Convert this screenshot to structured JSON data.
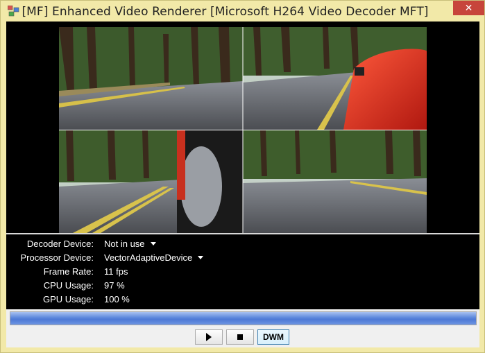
{
  "window": {
    "title": "[MF]  Enhanced Video Renderer  [Microsoft H264 Video Decoder MFT]",
    "close_glyph": "✕"
  },
  "video": {
    "description_icon": "video-frame"
  },
  "info": {
    "decoder_device": {
      "label": "Decoder Device:",
      "value": "Not in use"
    },
    "processor_device": {
      "label": "Processor Device:",
      "value": "VectorAdaptiveDevice"
    },
    "frame_rate": {
      "label": "Frame Rate:",
      "value": "11 fps"
    },
    "cpu_usage": {
      "label": "CPU Usage:",
      "value": "97 %"
    },
    "gpu_usage": {
      "label": "GPU Usage:",
      "value": "100 %"
    }
  },
  "progress": {
    "value": 1.0
  },
  "controls": {
    "play_icon": "play-icon",
    "stop_icon": "stop-icon",
    "dwm_label": "DWM"
  },
  "colors": {
    "titlebar": "#f2e9a8",
    "close": "#c7453b",
    "progress": "#5c87dc"
  }
}
